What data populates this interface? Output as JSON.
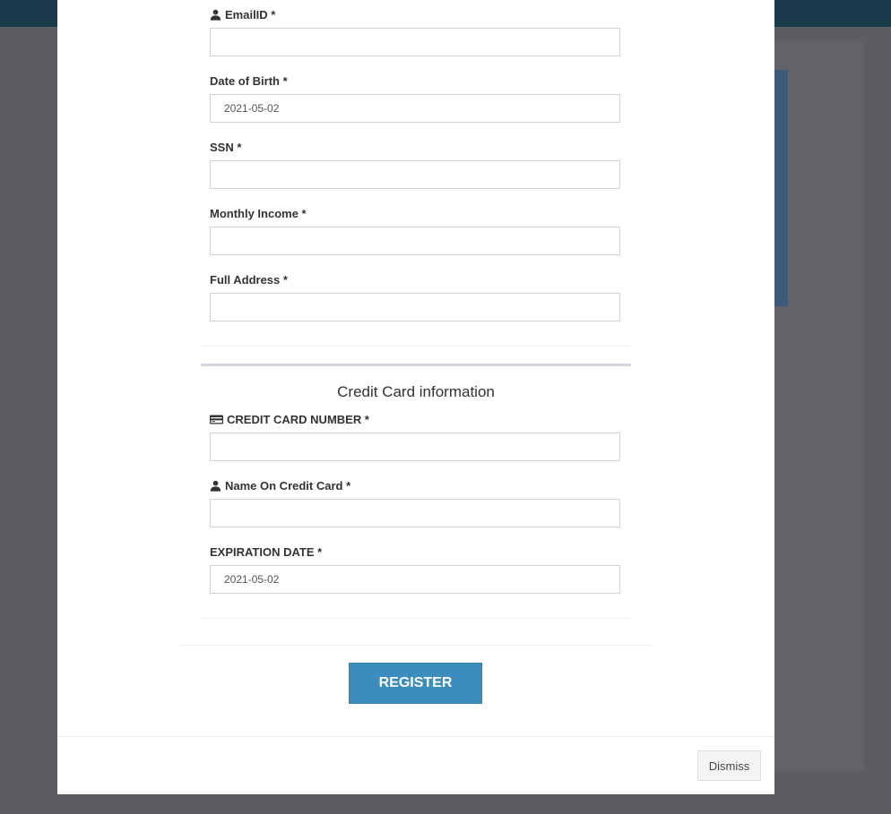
{
  "personal": {
    "fields": [
      {
        "label": "EmailID *",
        "icon": "user-icon",
        "value": ""
      },
      {
        "label": "Date of Birth *",
        "value": "2021-05-02"
      },
      {
        "label": "SSN *",
        "value": ""
      },
      {
        "label": "Monthly Income *",
        "value": ""
      },
      {
        "label": "Full Address *",
        "value": ""
      }
    ]
  },
  "credit_card": {
    "title": "Credit Card information",
    "fields": [
      {
        "label": "CREDIT CARD NUMBER *",
        "icon": "credit-card-icon",
        "value": ""
      },
      {
        "label": "Name On Credit Card *",
        "icon": "user-icon",
        "value": ""
      },
      {
        "label": "EXPIRATION DATE *",
        "value": "2021-05-02"
      }
    ]
  },
  "actions": {
    "register_label": "REGISTER",
    "dismiss_label": "Dismiss"
  },
  "colors": {
    "overlay": "#5b5d60",
    "topbar": "#193a4b",
    "primary": "#3c8dbc"
  }
}
